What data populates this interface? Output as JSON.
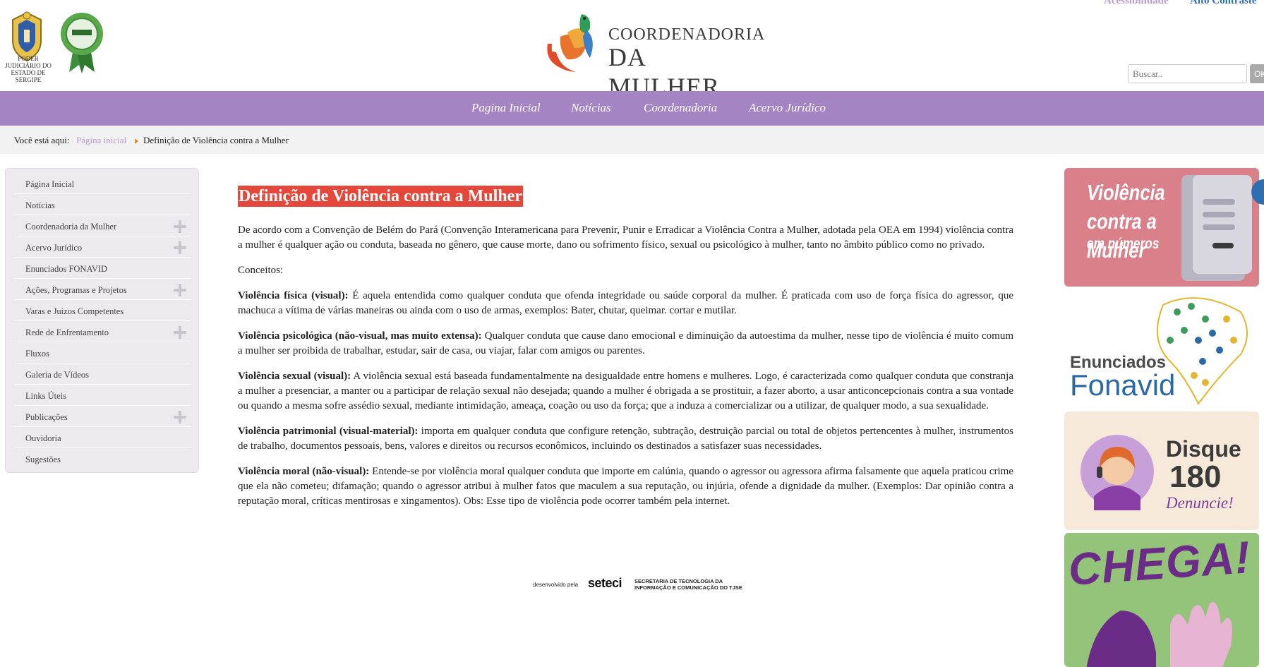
{
  "header": {
    "seal_label": "PODER JUDICIÁRIO DO ESTADO DE SERGIPE",
    "brand_line1": "COORDENADORIA",
    "brand_line2": "DA MULHER",
    "accessibility_link": "Acessibilidade",
    "contrast_link": "Alto Contraste",
    "search_placeholder": "Buscar..",
    "search_button": "OK"
  },
  "nav": {
    "items": [
      "Pagina Inicial",
      "Notícias",
      "Coordenadoria",
      "Acervo Jurídico"
    ]
  },
  "breadcrumb": {
    "prefix": "Você está aqui:",
    "home": "Página inicial",
    "current": "Definição de Violência contra a Mulher"
  },
  "sidebar": {
    "items": [
      {
        "label": "Página Inicial",
        "expandable": false
      },
      {
        "label": "Notícias",
        "expandable": false
      },
      {
        "label": "Coordenadoria da Mulher",
        "expandable": true
      },
      {
        "label": "Acervo Jurídico",
        "expandable": true
      },
      {
        "label": "Enunciados FONAVID",
        "expandable": false
      },
      {
        "label": "Ações, Programas e Projetos",
        "expandable": true
      },
      {
        "label": "Varas e Juizos Competentes",
        "expandable": false
      },
      {
        "label": "Rede de Enfrentamento",
        "expandable": true
      },
      {
        "label": "Fluxos",
        "expandable": false
      },
      {
        "label": "Galeria de Vídeos",
        "expandable": false
      },
      {
        "label": "Links Úteis",
        "expandable": false
      },
      {
        "label": "Publicações",
        "expandable": true
      },
      {
        "label": "Ouvidoria",
        "expandable": false
      },
      {
        "label": "Sugestões",
        "expandable": false
      }
    ]
  },
  "content": {
    "title": "Definição de Violência contra a Mulher",
    "intro": "De acordo com a Convenção de Belém do Pará (Convenção Interamericana para Prevenir, Punir e Erradicar a Violência Contra a Mulher, adotada pela OEA em 1994) violência contra a mulher é qualquer ação ou conduta, baseada no gênero, que cause morte, dano ou sofrimento físico, sexual ou psicológico à mulher, tanto no âmbito público como no privado.",
    "concepts_label": "Conceitos:",
    "concepts": [
      {
        "term": "Violência física (visual):",
        "text": " É aquela entendida como qualquer conduta que ofenda integridade ou saúde corporal da mulher. É praticada com uso de força física do agressor, que machuca a vítima de várias maneiras ou ainda com o uso de armas, exemplos: Bater, chutar, queimar. cortar e mutilar."
      },
      {
        "term": "Violência psicológica (não-visual, mas muito extensa):",
        "text": " Qualquer conduta que cause dano emocional e diminuição da autoestima da mulher, nesse tipo de violência é muito comum a mulher ser proibida de trabalhar, estudar, sair de casa, ou viajar, falar com amigos ou parentes."
      },
      {
        "term": "Violência sexual (visual):",
        "text": " A violência sexual está baseada fundamentalmente na desigualdade entre homens e mulheres. Logo, é caracterizada como qualquer conduta que constranja a mulher a presenciar, a manter ou a participar de relação sexual não desejada; quando a mulher é obrigada a se prostituir, a fazer aborto, a usar anticoncepcionais contra a sua vontade ou quando a mesma sofre assédio sexual, mediante intimidação, ameaça, coação ou uso da força; que a induza a comercializar ou a utilizar, de qualquer modo, a sua sexualidade."
      },
      {
        "term": "Violência patrimonial (visual-material):",
        "text": " importa em qualquer conduta que configure retenção, subtração, destruição parcial ou total de objetos pertencentes à mulher, instrumentos de trabalho, documentos pessoais, bens, valores e direitos ou recursos econômicos, incluindo os destinados a satisfazer suas necessidades."
      },
      {
        "term": "Violência moral (não-visual):",
        "text": " Entende-se por violência moral qualquer conduta que importe em calúnia, quando o agressor ou agressora afirma falsamente que aquela praticou crime que ela não cometeu; difamação; quando o agressor atribui à mulher fatos que maculem a sua reputação, ou injúria, ofende a dignidade da mulher. (Exemplos: Dar opinião contra a reputação moral, críticas mentirosas e xingamentos). Obs: Esse tipo de violência pode ocorrer também pela internet."
      }
    ]
  },
  "footer": {
    "developed_by": "desenvolvido pela",
    "logo": "seteci",
    "org_line1": "SECRETARIA DE TECNOLOGIA DA",
    "org_line2": "INFORMAÇÃO E COMUNICAÇÃO DO TJSE"
  },
  "banners": {
    "violencia_title": "Violência contra a Mulher",
    "violencia_subtitle": "em números",
    "fonavid_line1": "Enunciados",
    "fonavid_line2": "Fonavid",
    "disque_line1": "Disque",
    "disque_line2": "180",
    "disque_line3": "Denuncie!",
    "chega": "CHEGA!"
  },
  "colors": {
    "nav_purple": "#a584c3",
    "title_red": "#e5473b",
    "link_lilac": "#b89ad3",
    "contrast_blue": "#2f6fb0"
  }
}
